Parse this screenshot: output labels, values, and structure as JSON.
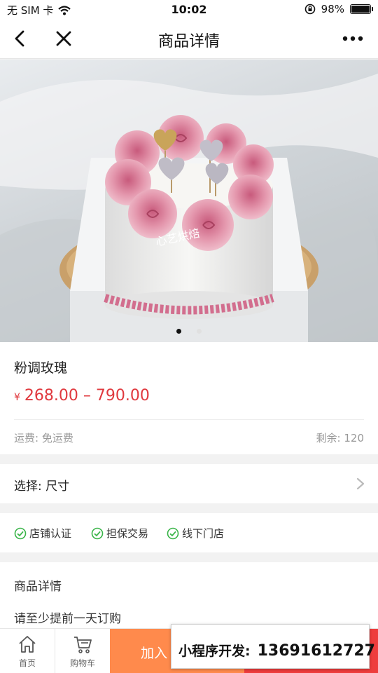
{
  "status_bar": {
    "carrier": "无 SIM 卡",
    "time": "10:02",
    "battery": "98%"
  },
  "navbar": {
    "title": "商品详情",
    "icons": [
      "back-icon",
      "close-icon",
      "more-icon"
    ]
  },
  "gallery": {
    "watermark": "心艺烘焙",
    "image_count": 2,
    "active_index": 0
  },
  "product": {
    "name": "粉调玫瑰",
    "currency": "¥",
    "price_range": "268.00 – 790.00",
    "shipping": "运费: 免运费",
    "stock": "剩余: 120"
  },
  "option": {
    "label": "选择: 尺寸"
  },
  "guarantees": [
    "店铺认证",
    "担保交易",
    "线下门店"
  ],
  "details": {
    "heading": "商品详情",
    "note": "请至少提前一天订购"
  },
  "bottom_bar": {
    "home_label": "首页",
    "cart_label": "购物车",
    "add_to_cart_label": "加入"
  },
  "promo_banner": {
    "label": "小程序开发:",
    "phone": "13691612727"
  },
  "colors": {
    "price": "#e0393e",
    "add_to_cart": "#ff8a4c",
    "buy": "#ee3d3d",
    "check": "#3bb54a"
  }
}
